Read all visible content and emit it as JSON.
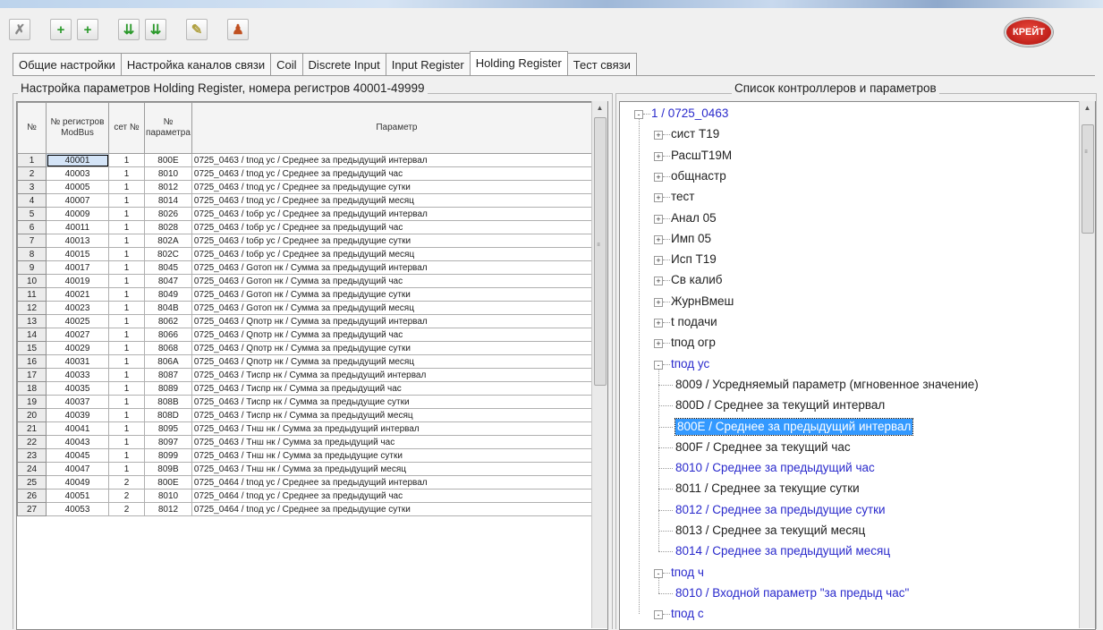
{
  "tabs": [
    "Общие настройки",
    "Настройка каналов связи",
    "Coil",
    "Discrete Input",
    "Input Register",
    "Holding Register",
    "Тест связи"
  ],
  "active_tab_index": 5,
  "logo_text": "КРЕЙТ",
  "left_panel": {
    "caption": "Настройка параметров Holding Register, номера регистров 40001-49999",
    "columns": [
      "№",
      "№ регистров ModBus",
      "сет №",
      "№ параметра",
      "Параметр"
    ],
    "rows": [
      [
        "1",
        "40001",
        "1",
        "800E",
        "0725_0463 / tпод ус / Среднее за предыдущий интервал"
      ],
      [
        "2",
        "40003",
        "1",
        "8010",
        "0725_0463 / tпод ус / Среднее за предыдущий час"
      ],
      [
        "3",
        "40005",
        "1",
        "8012",
        "0725_0463 / tпод ус / Среднее за предыдущие сутки"
      ],
      [
        "4",
        "40007",
        "1",
        "8014",
        "0725_0463 / tпод ус / Среднее за предыдущий месяц"
      ],
      [
        "5",
        "40009",
        "1",
        "8026",
        "0725_0463 / tобр ус / Среднее за предыдущий интервал"
      ],
      [
        "6",
        "40011",
        "1",
        "8028",
        "0725_0463 / tобр ус / Среднее за предыдущий час"
      ],
      [
        "7",
        "40013",
        "1",
        "802A",
        "0725_0463 / tобр ус / Среднее за предыдущие сутки"
      ],
      [
        "8",
        "40015",
        "1",
        "802C",
        "0725_0463 / tобр ус / Среднее за предыдущий месяц"
      ],
      [
        "9",
        "40017",
        "1",
        "8045",
        "0725_0463 / Gотоп нк / Сумма за предыдущий интервал"
      ],
      [
        "10",
        "40019",
        "1",
        "8047",
        "0725_0463 / Gотоп нк / Сумма за предыдущий час"
      ],
      [
        "11",
        "40021",
        "1",
        "8049",
        "0725_0463 / Gотоп нк / Сумма за предыдущие сутки"
      ],
      [
        "12",
        "40023",
        "1",
        "804B",
        "0725_0463 / Gотоп нк / Сумма за предыдущий месяц"
      ],
      [
        "13",
        "40025",
        "1",
        "8062",
        "0725_0463 / Qпотр нк / Сумма за предыдущий интервал"
      ],
      [
        "14",
        "40027",
        "1",
        "8066",
        "0725_0463 / Qпотр нк / Сумма за предыдущий час"
      ],
      [
        "15",
        "40029",
        "1",
        "8068",
        "0725_0463 / Qпотр нк / Сумма за предыдущие сутки"
      ],
      [
        "16",
        "40031",
        "1",
        "806A",
        "0725_0463 / Qпотр нк / Сумма за предыдущий месяц"
      ],
      [
        "17",
        "40033",
        "1",
        "8087",
        "0725_0463 / Тиспр нк / Сумма за предыдущий интервал"
      ],
      [
        "18",
        "40035",
        "1",
        "8089",
        "0725_0463 / Тиспр нк / Сумма за предыдущий час"
      ],
      [
        "19",
        "40037",
        "1",
        "808B",
        "0725_0463 / Тиспр нк / Сумма за предыдущие сутки"
      ],
      [
        "20",
        "40039",
        "1",
        "808D",
        "0725_0463 / Тиспр нк / Сумма за предыдущий месяц"
      ],
      [
        "21",
        "40041",
        "1",
        "8095",
        "0725_0463 / Тнш нк / Сумма за предыдущий интервал"
      ],
      [
        "22",
        "40043",
        "1",
        "8097",
        "0725_0463 / Тнш нк / Сумма за предыдущий час"
      ],
      [
        "23",
        "40045",
        "1",
        "8099",
        "0725_0463 / Тнш нк / Сумма за предыдущие сутки"
      ],
      [
        "24",
        "40047",
        "1",
        "809B",
        "0725_0463 / Тнш нк / Сумма за предыдущий месяц"
      ],
      [
        "25",
        "40049",
        "2",
        "800E",
        "0725_0464 / tпод ус  / Среднее за предыдущий интервал"
      ],
      [
        "26",
        "40051",
        "2",
        "8010",
        "0725_0464 / tпод ус  / Среднее за предыдущий час"
      ],
      [
        "27",
        "40053",
        "2",
        "8012",
        "0725_0464 / tпод ус  / Среднее за предыдущие сутки"
      ]
    ]
  },
  "right_panel": {
    "caption": "Список контроллеров и параметров",
    "tree": [
      {
        "label": "1 / 0725_0463",
        "level": 0,
        "expander": "-",
        "color": "blue"
      },
      {
        "label": "сист Т19",
        "level": 1,
        "expander": "+"
      },
      {
        "label": "РасшТ19М",
        "level": 1,
        "expander": "+"
      },
      {
        "label": "общнастр",
        "level": 1,
        "expander": "+"
      },
      {
        "label": "тест",
        "level": 1,
        "expander": "+"
      },
      {
        "label": "Анал 05",
        "level": 1,
        "expander": "+"
      },
      {
        "label": "Имп 05",
        "level": 1,
        "expander": "+"
      },
      {
        "label": "Исп Т19",
        "level": 1,
        "expander": "+"
      },
      {
        "label": "Св калиб",
        "level": 1,
        "expander": "+"
      },
      {
        "label": "ЖурнВмеш",
        "level": 1,
        "expander": "+"
      },
      {
        "label": "t подачи",
        "level": 1,
        "expander": "+"
      },
      {
        "label": "tпод огр",
        "level": 1,
        "expander": "+"
      },
      {
        "label": "tпод ус",
        "level": 1,
        "expander": "-",
        "color": "blue"
      },
      {
        "label": "8009 / Усредняемый параметр (мгновенное значение)",
        "level": 2
      },
      {
        "label": "800D / Среднее за текущий интервал",
        "level": 2
      },
      {
        "label": "800E / Среднее за предыдущий интервал",
        "level": 2,
        "selected": true
      },
      {
        "label": "800F / Среднее за текущий час",
        "level": 2
      },
      {
        "label": "8010 / Среднее за предыдущий час",
        "level": 2,
        "color": "blue"
      },
      {
        "label": "8011 / Среднее за текущие сутки",
        "level": 2
      },
      {
        "label": "8012 / Среднее за предыдущие сутки",
        "level": 2,
        "color": "blue"
      },
      {
        "label": "8013 / Среднее за текущий месяц",
        "level": 2
      },
      {
        "label": "8014 / Среднее за предыдущий месяц",
        "level": 2,
        "color": "blue"
      },
      {
        "label": "tпод ч",
        "level": 1,
        "expander": "-",
        "color": "blue"
      },
      {
        "label": "8010 / Входной параметр \"за предыд час\"",
        "level": 2,
        "color": "blue"
      },
      {
        "label": "tпод с",
        "level": 1,
        "expander": "-",
        "color": "blue"
      }
    ]
  },
  "toolbar": [
    {
      "icon": "delete-icon",
      "glyph": "✗",
      "color": "#888888"
    },
    {
      "icon": "add-icon",
      "glyph": "+",
      "color": "#2c9a2c"
    },
    {
      "icon": "add-icon",
      "glyph": "+",
      "color": "#2c9a2c"
    },
    {
      "icon": "move-down-icon",
      "glyph": "⇊",
      "color": "#2c9a2c"
    },
    {
      "icon": "move-down-icon",
      "glyph": "⇊",
      "color": "#2c9a2c"
    },
    {
      "icon": "edit-icon",
      "glyph": "✎",
      "color": "#b0a040"
    },
    {
      "icon": "user-icon",
      "glyph": "♟",
      "color": "#c05020"
    }
  ]
}
